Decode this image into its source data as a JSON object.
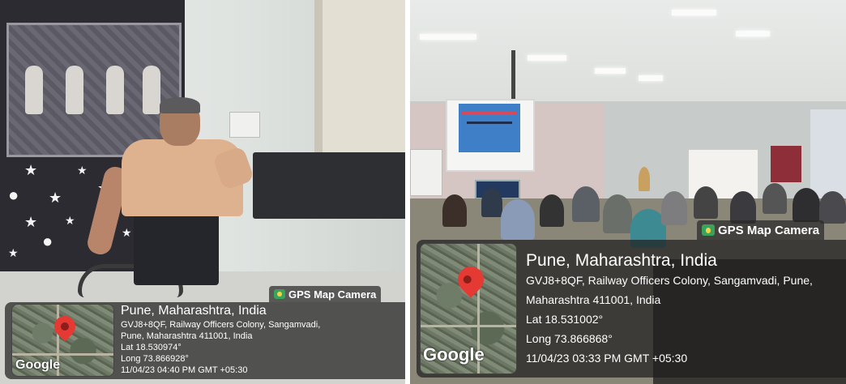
{
  "left_photo": {
    "gps_tag": "GPS Map Camera",
    "map_watermark": "Google",
    "location_title": "Pune, Maharashtra, India",
    "address_line1": "GVJ8+8QF, Railway Officers Colony, Sangamvadi,",
    "address_line2": "Pune, Maharashtra 411001, India",
    "latitude": "Lat 18.530974°",
    "longitude": "Long 73.866928°",
    "timestamp": "11/04/23 04:40 PM GMT +05:30"
  },
  "right_photo": {
    "gps_tag": "GPS Map Camera",
    "map_watermark": "Google",
    "location_title": "Pune, Maharashtra, India",
    "address_line1": "GVJ8+8QF, Railway Officers Colony, Sangamvadi, Pune,",
    "address_line2": "Maharashtra 411001, India",
    "latitude": "Lat 18.531002°",
    "longitude": "Long 73.866868°",
    "timestamp": "11/04/23 03:33 PM GMT +05:30"
  },
  "colors": {
    "map_pin": "#e53a34",
    "gps_tag_icon": "#3aa25b",
    "overlay_bg": "rgba(30,30,30,0.72)"
  }
}
